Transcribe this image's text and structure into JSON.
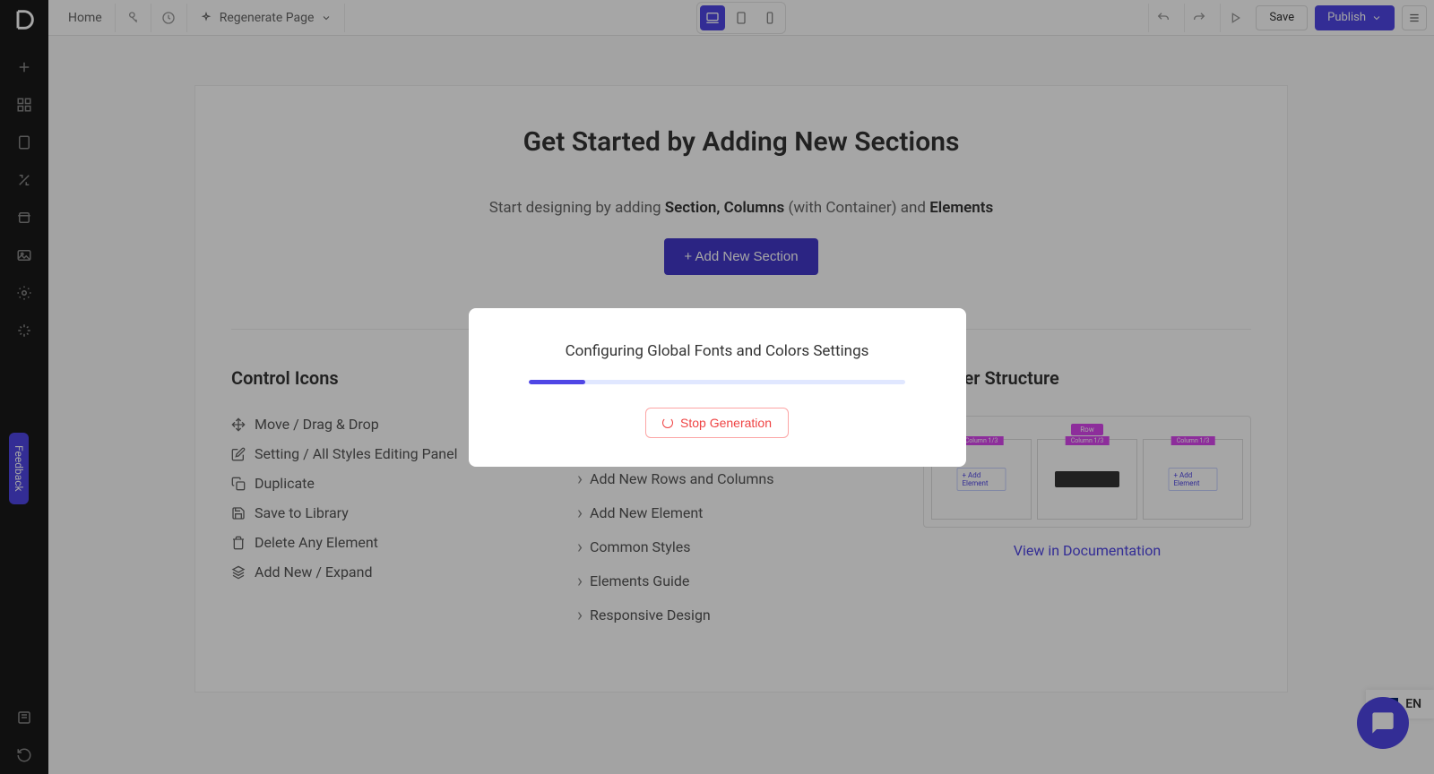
{
  "topbar": {
    "home": "Home",
    "regenerate": "Regenerate Page",
    "save": "Save",
    "publish": "Publish"
  },
  "sidebar": {
    "feedback": "Feedback"
  },
  "hero": {
    "title": "Get Started by Adding New Sections",
    "sub_pre": "Start designing by adding ",
    "sub_b1": "Section, Columns",
    "sub_mid": " (with Container) and ",
    "sub_b2": "Elements",
    "add_btn": "+ Add New Section"
  },
  "cols": {
    "control": {
      "title": "Control Icons",
      "items": [
        "Move / Drag & Drop",
        "Setting / All Styles Editing Panel",
        "Duplicate",
        "Save to Library",
        "Delete Any Element",
        "Add New / Expand"
      ]
    },
    "docs": {
      "items": [
        "Add New Rows and Columns",
        "Add New Element",
        "Common Styles",
        "Elements Guide",
        "Responsive Design"
      ]
    },
    "builder": {
      "title": "Builder Structure",
      "doc_link": "View in Documentation",
      "row_tag": "Row",
      "col_tag": "Column 1/3",
      "add_el": "+ Add Element"
    }
  },
  "modal": {
    "title": "Configuring Global Fonts and Colors Settings",
    "stop": "Stop Generation",
    "progress_pct": 15
  },
  "lang": "EN"
}
